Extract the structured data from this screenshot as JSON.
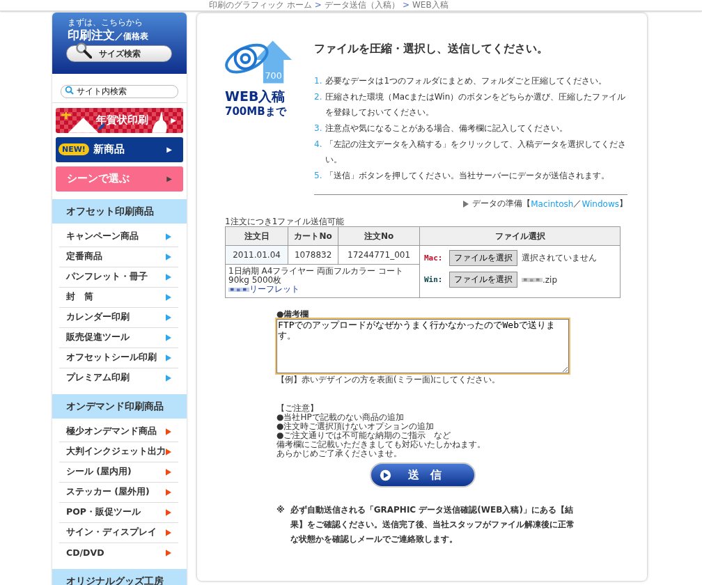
{
  "breadcrumb": [
    {
      "label": "印刷のグラフィック ホーム"
    },
    {
      "separator": ">",
      "label": "データ送信（入稿）"
    },
    {
      "separator": ">",
      "label": "WEB入稿"
    }
  ],
  "sidebar": {
    "order_box": {
      "caption": "まずは、こちらから",
      "title": "印刷注文",
      "subtitle": "／価格表",
      "button": "サイズ検索"
    },
    "search": {
      "placeholder": "サイト内検索"
    },
    "banners": [
      {
        "kind": "nenga",
        "label": "年賀状印刷",
        "arrow": "▶"
      },
      {
        "kind": "new",
        "badge": "NEW!",
        "label": "新商品",
        "arrow": "▶"
      },
      {
        "kind": "scene",
        "label": "シーンで選ぶ",
        "arrow": "▶"
      }
    ],
    "sections": [
      {
        "title": "オフセット印刷商品",
        "color": "#2ea7ee",
        "items": [
          "キャンペーン商品",
          "定番商品",
          "パンフレット・冊子",
          "封　筒",
          "カレンダー印刷",
          "販売促進ツール",
          "オフセットシール印刷",
          "プレミアム印刷"
        ]
      },
      {
        "title": "オンデマンド印刷商品",
        "color": "#f04a12",
        "items": [
          "極少オンデマンド商品",
          "大判インクジェット出力",
          "シール (屋内用)",
          "ステッカー (屋外用)",
          "POP・販促ツール",
          "サイン・ディスプレイ",
          "CD/DVD"
        ]
      },
      {
        "title": "オリジナルグッズ工房"
      }
    ]
  },
  "main": {
    "logo": {
      "badge": "700",
      "title": "WEB入稿",
      "subtitle": "700MBまで"
    },
    "heading": "ファイルを圧縮・選択し、送信してください。",
    "steps": [
      {
        "number": "1.",
        "text": "必要なデータは1つのフォルダにまとめ、フォルダごと圧縮してください。"
      },
      {
        "number": "2.",
        "text": "圧縮された環境（MacまたはWin）のボタンをどちらか選び、圧縮したファイルを登録しておいてください。"
      },
      {
        "number": "3.",
        "text": "注意点や気になることがある場合、備考欄に記入してください。"
      },
      {
        "number": "4.",
        "text": "「左記の注文データを入稿する」をクリックして、入稿データを選択してください。"
      },
      {
        "number": "5.",
        "text": "「送信」ボタンを押してください。当社サーバーにデータが送信されます。"
      }
    ],
    "data_prep": {
      "label": "データの準備【",
      "links": [
        "Macintosh",
        "Windows"
      ],
      "separator": "／",
      "close": "】"
    },
    "table": {
      "note": "1注文につき1ファイル送信可能",
      "columns": [
        "注文日",
        "カートNo",
        "注文No",
        "ファイル選択"
      ],
      "order": {
        "date": "2011.01.04",
        "cart": "1078832",
        "number": "17244771_001",
        "description": [
          "1日納期 A4フライヤー 両面フルカラー コート",
          "90kg 5000枚"
        ],
        "link": "リーフレット",
        "link_redacted": true
      },
      "uploads": [
        {
          "platform": "Mac:",
          "color": "#c0102a",
          "button": "ファイルを選択",
          "status": "選択されていません",
          "redacted": false
        },
        {
          "platform": "Win:",
          "color": "#0c4a52",
          "button": "ファイルを選択",
          "status": ".zip",
          "redacted": true
        }
      ]
    },
    "remarks": {
      "label": "●備考欄",
      "value": "FTPでのアップロードがなぜかうまく行かなかったのでWebで送ります。",
      "focused": true,
      "example": "【例】赤いデザインの方を表面(ミラー面)にしてください。"
    },
    "notice": [
      "【ご注意】",
      "●当社HPで記載のない商品の追加",
      "●注文時ご選択頂けないオプションの追加",
      "●ご注文通りでは不可能な納期のご指示　など",
      "備考欄にご記載いただきましても対応いたしかねます。",
      "あらかじめご了承くださいませ。"
    ],
    "submit": {
      "label": "送　信"
    },
    "footnote": {
      "mark": "※",
      "text": "必ず自動送信される「GRAPHIC データ送信確認(WEB入稿)」にある【結果】をご確認ください。送信完了後、当社スタッフがファイル解凍後に正常な状態かを確認しメールでご連絡致します。"
    }
  }
}
